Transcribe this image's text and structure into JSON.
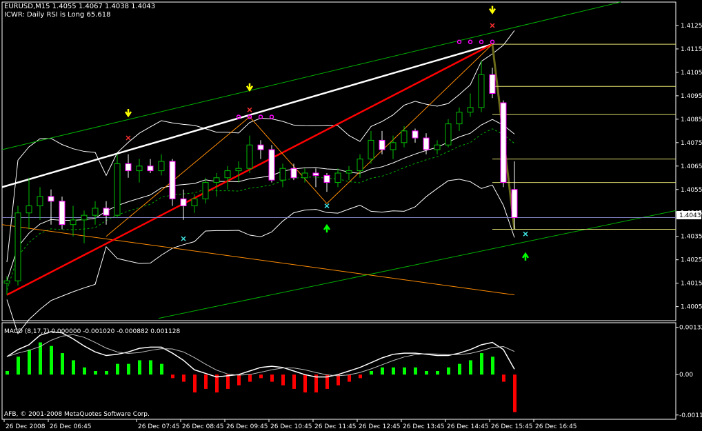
{
  "header": {
    "symbol_line": "EURUSD,M15  1.4055 1.4067 1.4038 1.4043",
    "indicator_line": "ICWR: Daily RSI is Long 65.618"
  },
  "macd": {
    "label": "MACD (8,17,7) 0.000000 -0.001020 -0.000882 0.001128"
  },
  "copyright": "AFB, © 2001-2008 MetaQuotes Software Corp.",
  "current_price": "1.4043",
  "colors": {
    "background": "#000000",
    "bull_candle": "#00c000",
    "bear_candle": "#ff00ff",
    "band": "#ffffff",
    "trend_green": "#00b000",
    "zigzag_red": "#ff0000",
    "zigzag_orange": "#ff8c00",
    "fib_level": "#e0e070",
    "macd_up": "#00ff00",
    "macd_down": "#ff0000",
    "axis_text": "#ffffff"
  },
  "chart_data": {
    "type": "candlestick",
    "symbol": "EURUSD",
    "timeframe": "M15",
    "price_ticks": [
      "1.4125",
      "1.4115",
      "1.4105",
      "1.4095",
      "1.4085",
      "1.4075",
      "1.4065",
      "1.4055",
      "1.4045",
      "1.4035",
      "1.4025",
      "1.4015",
      "1.4005"
    ],
    "price_tick_values": [
      1.4125,
      1.4115,
      1.4105,
      1.4095,
      1.4085,
      1.4075,
      1.4065,
      1.4055,
      1.4045,
      1.4035,
      1.4025,
      1.4015,
      1.4005
    ],
    "price_range": [
      1.3999,
      1.4135
    ],
    "macd_ticks": [
      "0.00132",
      "0.00",
      "-0.00113"
    ],
    "macd_tick_values": [
      0.00132,
      0.0,
      -0.00113
    ],
    "macd_range": [
      -0.00125,
      0.00145
    ],
    "time_labels": [
      "26 Dec 2008",
      "26 Dec 06:45",
      "26 Dec 07:45",
      "26 Dec 08:45",
      "26 Dec 09:45",
      "26 Dec 10:45",
      "26 Dec 11:45",
      "26 Dec 12:45",
      "26 Dec 13:45",
      "26 Dec 14:45",
      "26 Dec 15:45",
      "26 Dec 16:45"
    ],
    "time_label_bars": [
      0,
      4,
      12,
      16,
      20,
      24,
      28,
      32,
      36,
      40,
      44,
      48
    ],
    "candles": [
      [
        1.4015,
        1.4018,
        1.401,
        1.4016
      ],
      [
        1.4016,
        1.4048,
        1.4014,
        1.4045
      ],
      [
        1.4045,
        1.406,
        1.4038,
        1.4048
      ],
      [
        1.4048,
        1.4056,
        1.4042,
        1.4052
      ],
      [
        1.4052,
        1.4055,
        1.404,
        1.405
      ],
      [
        1.405,
        1.4052,
        1.4038,
        1.404
      ],
      [
        1.404,
        1.4048,
        1.4035,
        1.4042
      ],
      [
        1.4042,
        1.4046,
        1.4032,
        1.4044
      ],
      [
        1.4044,
        1.405,
        1.404,
        1.4047
      ],
      [
        1.4047,
        1.405,
        1.404,
        1.4044
      ],
      [
        1.4044,
        1.407,
        1.4043,
        1.4066
      ],
      [
        1.4066,
        1.407,
        1.406,
        1.4063
      ],
      [
        1.4063,
        1.4068,
        1.4058,
        1.4065
      ],
      [
        1.4065,
        1.4068,
        1.4062,
        1.4063
      ],
      [
        1.4063,
        1.407,
        1.4061,
        1.4067
      ],
      [
        1.4067,
        1.4068,
        1.4048,
        1.4051
      ],
      [
        1.4051,
        1.4055,
        1.4042,
        1.4048
      ],
      [
        1.4048,
        1.4053,
        1.4045,
        1.4051
      ],
      [
        1.4051,
        1.406,
        1.4049,
        1.4058
      ],
      [
        1.4058,
        1.4062,
        1.4052,
        1.406
      ],
      [
        1.406,
        1.4065,
        1.4055,
        1.4063
      ],
      [
        1.4063,
        1.4067,
        1.4058,
        1.4064
      ],
      [
        1.4064,
        1.4078,
        1.4062,
        1.4074
      ],
      [
        1.4074,
        1.4076,
        1.4068,
        1.4072
      ],
      [
        1.4072,
        1.4074,
        1.4058,
        1.4059
      ],
      [
        1.4059,
        1.4066,
        1.4056,
        1.4064
      ],
      [
        1.4064,
        1.4066,
        1.4059,
        1.406
      ],
      [
        1.406,
        1.4064,
        1.4058,
        1.4062
      ],
      [
        1.4062,
        1.4064,
        1.4056,
        1.4061
      ],
      [
        1.4061,
        1.4062,
        1.4054,
        1.4058
      ],
      [
        1.4058,
        1.4064,
        1.4056,
        1.4062
      ],
      [
        1.4062,
        1.4065,
        1.4059,
        1.4063
      ],
      [
        1.4063,
        1.407,
        1.406,
        1.4068
      ],
      [
        1.4068,
        1.408,
        1.4066,
        1.4076
      ],
      [
        1.4076,
        1.408,
        1.407,
        1.4072
      ],
      [
        1.4072,
        1.4078,
        1.4068,
        1.4075
      ],
      [
        1.4075,
        1.4082,
        1.4073,
        1.408
      ],
      [
        1.408,
        1.4081,
        1.4075,
        1.4077
      ],
      [
        1.4077,
        1.4079,
        1.407,
        1.4072
      ],
      [
        1.4072,
        1.4076,
        1.407,
        1.4074
      ],
      [
        1.4074,
        1.4085,
        1.4073,
        1.4083
      ],
      [
        1.4083,
        1.409,
        1.408,
        1.4088
      ],
      [
        1.4088,
        1.4096,
        1.4086,
        1.409
      ],
      [
        1.409,
        1.411,
        1.4088,
        1.4104
      ],
      [
        1.4104,
        1.4107,
        1.4094,
        1.4096
      ],
      [
        1.4092,
        1.4093,
        1.4056,
        1.4058
      ],
      [
        1.4055,
        1.4067,
        1.4038,
        1.4043
      ]
    ],
    "macd_hist": [
      0.0001,
      0.0005,
      0.0007,
      0.0009,
      0.0008,
      0.0006,
      0.0004,
      0.0002,
      0.0001,
      0.0001,
      0.0003,
      0.0003,
      0.0004,
      0.0004,
      0.0003,
      -0.0001,
      -0.0002,
      -0.0005,
      -0.0004,
      -0.0005,
      -0.0004,
      -0.0003,
      -0.0002,
      -0.0001,
      -0.0002,
      -0.0003,
      -0.0004,
      -0.0005,
      -0.0005,
      -0.0004,
      -0.0003,
      -0.0002,
      -0.0001,
      0.0001,
      0.0002,
      0.0002,
      0.0002,
      0.0002,
      0.0001,
      0.0001,
      0.0002,
      0.0003,
      0.0004,
      0.0006,
      0.0005,
      -0.0002,
      -0.00105
    ],
    "price_line": 1.4043
  }
}
